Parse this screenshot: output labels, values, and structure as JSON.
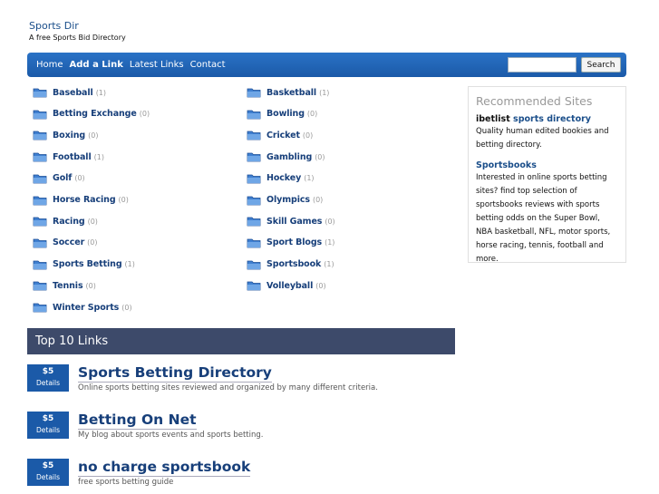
{
  "header": {
    "title": "Sports Dir",
    "tagline": "A free Sports Bid Directory"
  },
  "nav": {
    "links": [
      "Home",
      "Add a Link",
      "Latest Links",
      "Contact"
    ],
    "search_value": "",
    "search_button": "Search"
  },
  "categories": {
    "left": [
      {
        "name": "Baseball",
        "count": "(1)"
      },
      {
        "name": "Betting Exchange",
        "count": "(0)"
      },
      {
        "name": "Boxing",
        "count": "(0)"
      },
      {
        "name": "Football",
        "count": "(1)"
      },
      {
        "name": "Golf",
        "count": "(0)"
      },
      {
        "name": "Horse Racing",
        "count": "(0)"
      },
      {
        "name": "Racing",
        "count": "(0)"
      },
      {
        "name": "Soccer",
        "count": "(0)"
      },
      {
        "name": "Sports Betting",
        "count": "(1)"
      },
      {
        "name": "Tennis",
        "count": "(0)"
      },
      {
        "name": "Winter Sports",
        "count": "(0)"
      }
    ],
    "right": [
      {
        "name": "Basketball",
        "count": "(1)"
      },
      {
        "name": "Bowling",
        "count": "(0)"
      },
      {
        "name": "Cricket",
        "count": "(0)"
      },
      {
        "name": "Gambling",
        "count": "(0)"
      },
      {
        "name": "Hockey",
        "count": "(1)"
      },
      {
        "name": "Olympics",
        "count": "(0)"
      },
      {
        "name": "Skill Games",
        "count": "(0)"
      },
      {
        "name": "Sport Blogs",
        "count": "(1)"
      },
      {
        "name": "Sportsbook",
        "count": "(1)"
      },
      {
        "name": "Volleyball",
        "count": "(0)"
      }
    ]
  },
  "recommended": {
    "title": "Recommended Sites",
    "entries": [
      {
        "title_black": "ibetlist",
        "title_blue": " sports directory",
        "text": "Quality human edited bookies and betting directory."
      },
      {
        "title_black": "",
        "title_blue": "Sportsbooks",
        "text": "Interested in online sports betting sites? find top selection of sportsbooks reviews with sports betting odds on the Super Bowl, NBA basketball, NFL, motor sports, horse racing, tennis, football and more."
      }
    ]
  },
  "top_links": {
    "title": "Top 10 Links",
    "items": [
      {
        "price": "$5",
        "details": "Details",
        "title": "Sports Betting Directory",
        "desc": "Online sports betting sites reviewed and organized by many different criteria."
      },
      {
        "price": "$5",
        "details": "Details",
        "title": "Betting On Net",
        "desc": "My blog about sports events and sports betting."
      },
      {
        "price": "$5",
        "details": "Details",
        "title": "no charge sportsbook",
        "desc": "free sports betting guide"
      }
    ]
  }
}
